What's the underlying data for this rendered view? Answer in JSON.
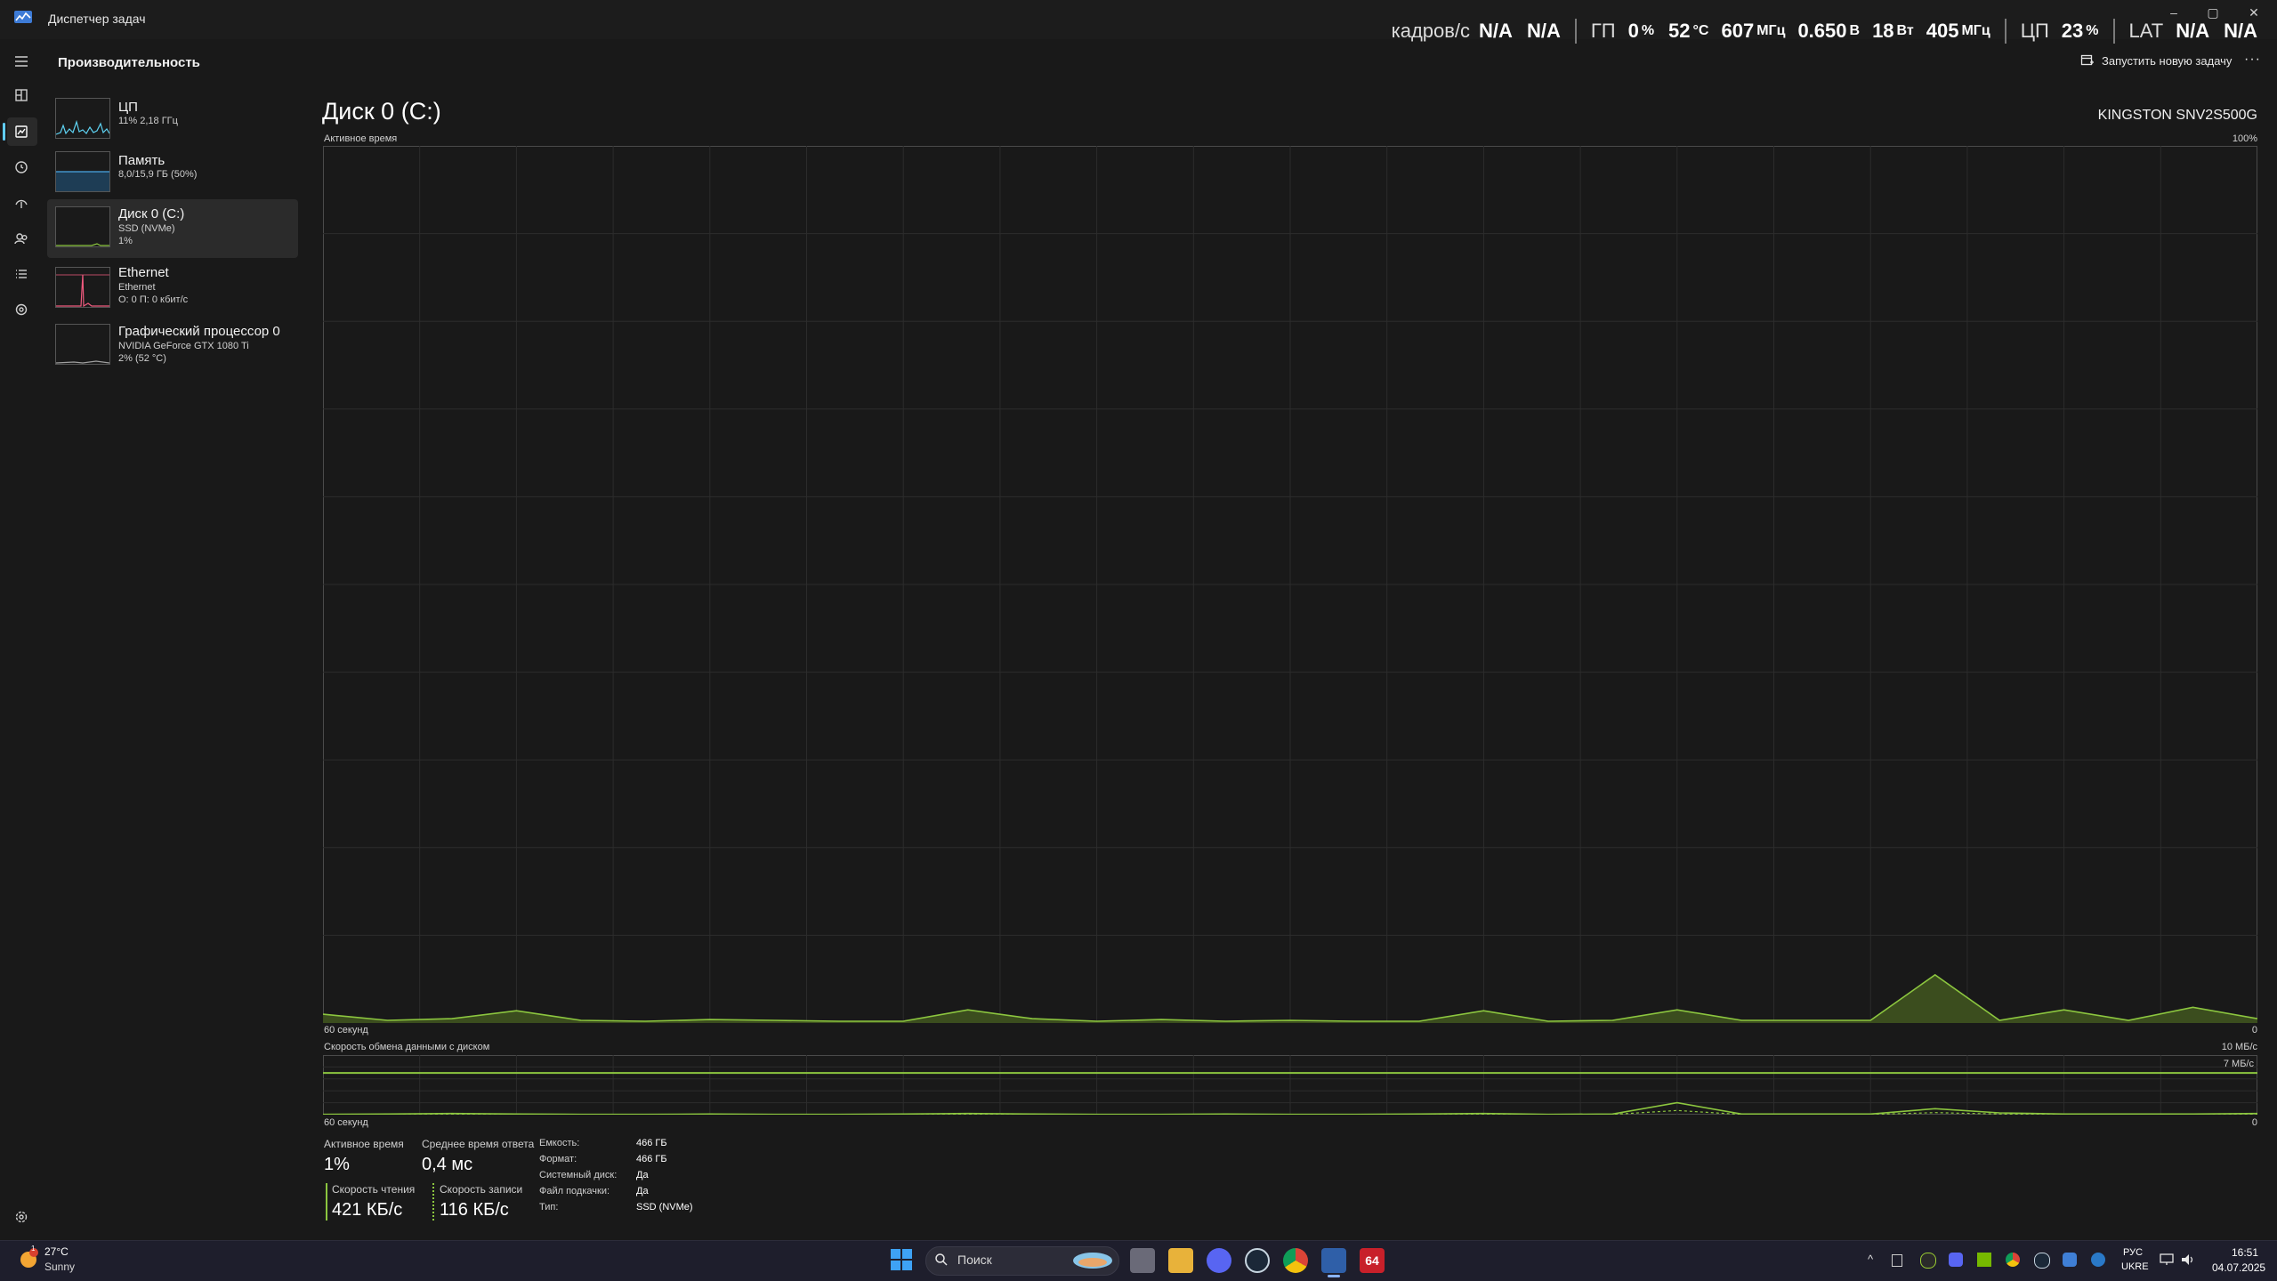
{
  "window": {
    "title": "Диспетчер задач",
    "minimize": "–",
    "maximize": "▢",
    "close": "✕"
  },
  "overlay": {
    "fps_label": "кадров/с",
    "fps_value1": "N/A",
    "fps_value2": "N/A",
    "gpu_label": "ГП",
    "gpu_load": "0",
    "gpu_load_unit": "%",
    "gpu_temp": "52",
    "gpu_temp_unit": "°C",
    "gpu_clock": "607",
    "gpu_clock_unit": "МГц",
    "gpu_voltage": "0.650",
    "gpu_voltage_unit": "В",
    "gpu_power": "18",
    "gpu_power_unit": "Вт",
    "gpu_mem_clock": "405",
    "gpu_mem_clock_unit": "МГц",
    "cpu_label": "ЦП",
    "cpu_load": "23",
    "cpu_load_unit": "%",
    "lat_label": "LAT",
    "lat_value1": "N/A",
    "lat_value2": "N/A"
  },
  "header": {
    "section_title": "Производительность",
    "run_new_task": "Запустить новую задачу",
    "more": "···"
  },
  "nav": {
    "icons": [
      "hamburger-icon",
      "processes-icon",
      "performance-icon",
      "app-history-icon",
      "startup-icon",
      "users-icon",
      "details-icon",
      "services-icon",
      "settings-icon"
    ]
  },
  "devices": [
    {
      "name": "ЦП",
      "sub1": "11% 2,18 ГГц",
      "sub2": "",
      "color": "#5ed3f3"
    },
    {
      "name": "Память",
      "sub1": "8,0/15,9 ГБ (50%)",
      "sub2": "",
      "color": "#4aa8e8"
    },
    {
      "name": "Диск 0 (C:)",
      "sub1": "SSD (NVMe)",
      "sub2": "1%",
      "color": "#8cc63f"
    },
    {
      "name": "Ethernet",
      "sub1": "Ethernet",
      "sub2": "О: 0 П: 0 кбит/с",
      "color": "#f05a7e"
    },
    {
      "name": "Графический процессор 0",
      "sub1": "NVIDIA GeForce GTX 1080 Ti",
      "sub2": "2% (52 °C)",
      "color": "#a0a0a0"
    }
  ],
  "main": {
    "title": "Диск 0 (C:)",
    "model": "KINGSTON SNV2S500G",
    "chart1_label": "Активное время",
    "chart1_max": "100%",
    "chart1_time": "60 секунд",
    "chart1_min": "0",
    "chart2_label": "Скорость обмена данными с диском",
    "chart2_max": "10 МБ/с",
    "chart2_ref": "7 МБ/с",
    "chart2_time": "60 секунд",
    "chart2_min": "0"
  },
  "chart_data": [
    {
      "type": "area",
      "title": "Активное время",
      "ylabel": "%",
      "ylim": [
        0,
        100
      ],
      "x": [
        60,
        58,
        56,
        54,
        52,
        50,
        48,
        46,
        44,
        42,
        40,
        38,
        36,
        34,
        32,
        30,
        28,
        26,
        24,
        22,
        20,
        18,
        16,
        14,
        12,
        10,
        8,
        6,
        4,
        2,
        0
      ],
      "series": [
        {
          "values": [
            1,
            0.3,
            0.5,
            1.4,
            0.3,
            0.2,
            0.4,
            0.3,
            0.2,
            0.2,
            1.5,
            0.5,
            0.2,
            0.4,
            0.2,
            0.3,
            0.2,
            0.2,
            1.4,
            0.2,
            0.3,
            1.5,
            0.3,
            0.3,
            0.3,
            5.5,
            0.3,
            1.5,
            0.3,
            1.8,
            0.5
          ],
          "color": "#8cc63f"
        }
      ],
      "grid": true
    },
    {
      "type": "line",
      "title": "Скорость обмена данными с диском",
      "ylabel": "МБ/с",
      "ylim": [
        0,
        10
      ],
      "x": [
        60,
        58,
        56,
        54,
        52,
        50,
        48,
        46,
        44,
        42,
        40,
        38,
        36,
        34,
        32,
        30,
        28,
        26,
        24,
        22,
        20,
        18,
        16,
        14,
        12,
        10,
        8,
        6,
        4,
        2,
        0
      ],
      "series": [
        {
          "values": [
            0.05,
            0.1,
            0.2,
            0.1,
            0.05,
            0.05,
            0.1,
            0.05,
            0.05,
            0.1,
            0.2,
            0.1,
            0.05,
            0.05,
            0.1,
            0.05,
            0.05,
            0.1,
            0.2,
            0.05,
            0.1,
            2.0,
            0.1,
            0.1,
            0.1,
            1.0,
            0.3,
            0.1,
            0.1,
            0.1,
            0.2
          ],
          "color": "#8cc63f"
        }
      ],
      "reference_line": 7,
      "grid": true
    }
  ],
  "stats": {
    "active_time_label": "Активное время",
    "active_time_value": "1%",
    "avg_response_label": "Среднее время ответа",
    "avg_response_value": "0,4 мс",
    "read_label": "Скорость чтения",
    "read_value": "421 КБ/с",
    "write_label": "Скорость записи",
    "write_value": "116 КБ/с"
  },
  "props": [
    {
      "label": "Емкость:",
      "value": "466 ГБ"
    },
    {
      "label": "Формат:",
      "value": "466 ГБ"
    },
    {
      "label": "Системный диск:",
      "value": "Да"
    },
    {
      "label": "Файл подкачки:",
      "value": "Да"
    },
    {
      "label": "Тип:",
      "value": "SSD (NVMe)"
    }
  ],
  "taskbar": {
    "weather_temp": "27°C",
    "weather_desc": "Sunny",
    "weather_badge": "1",
    "search_placeholder": "Поиск",
    "lang1": "РУС",
    "lang2": "UKRE",
    "time": "16:51",
    "date": "04.07.2025",
    "app_badge": "64"
  }
}
